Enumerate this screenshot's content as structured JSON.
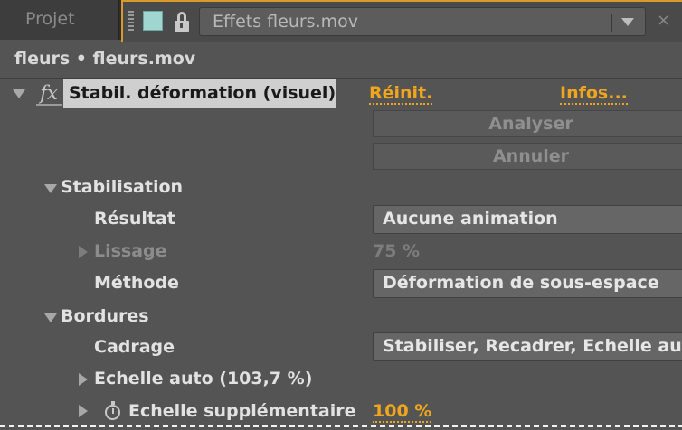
{
  "tabs": {
    "project_label": "Projet",
    "effects_label": "Effets fleurs.mov",
    "swatch_color": "#9fd6cf",
    "accent_color": "#d89a2a"
  },
  "breadcrumb": "fleurs • fleurs.mov",
  "effect": {
    "name": "Stabil. déformation (visuel)",
    "reset_label": "Réinit.",
    "info_label": "Infos...",
    "analyze_button": "Analyser",
    "cancel_button": "Annuler"
  },
  "stabilisation": {
    "heading": "Stabilisation",
    "result_label": "Résultat",
    "result_value": "Aucune animation",
    "smoothing_label": "Lissage",
    "smoothing_value": "75 %",
    "method_label": "Méthode",
    "method_value": "Déformation de sous-espace"
  },
  "borders": {
    "heading": "Bordures",
    "framing_label": "Cadrage",
    "framing_value": "Stabiliser, Recadrer, Echelle auto",
    "auto_scale_label": "Echelle auto (103,7 %)",
    "extra_scale_label": "Echelle supplémentaire",
    "extra_scale_value": "100 %"
  },
  "icons": {
    "fx": "fx",
    "close": "×"
  }
}
